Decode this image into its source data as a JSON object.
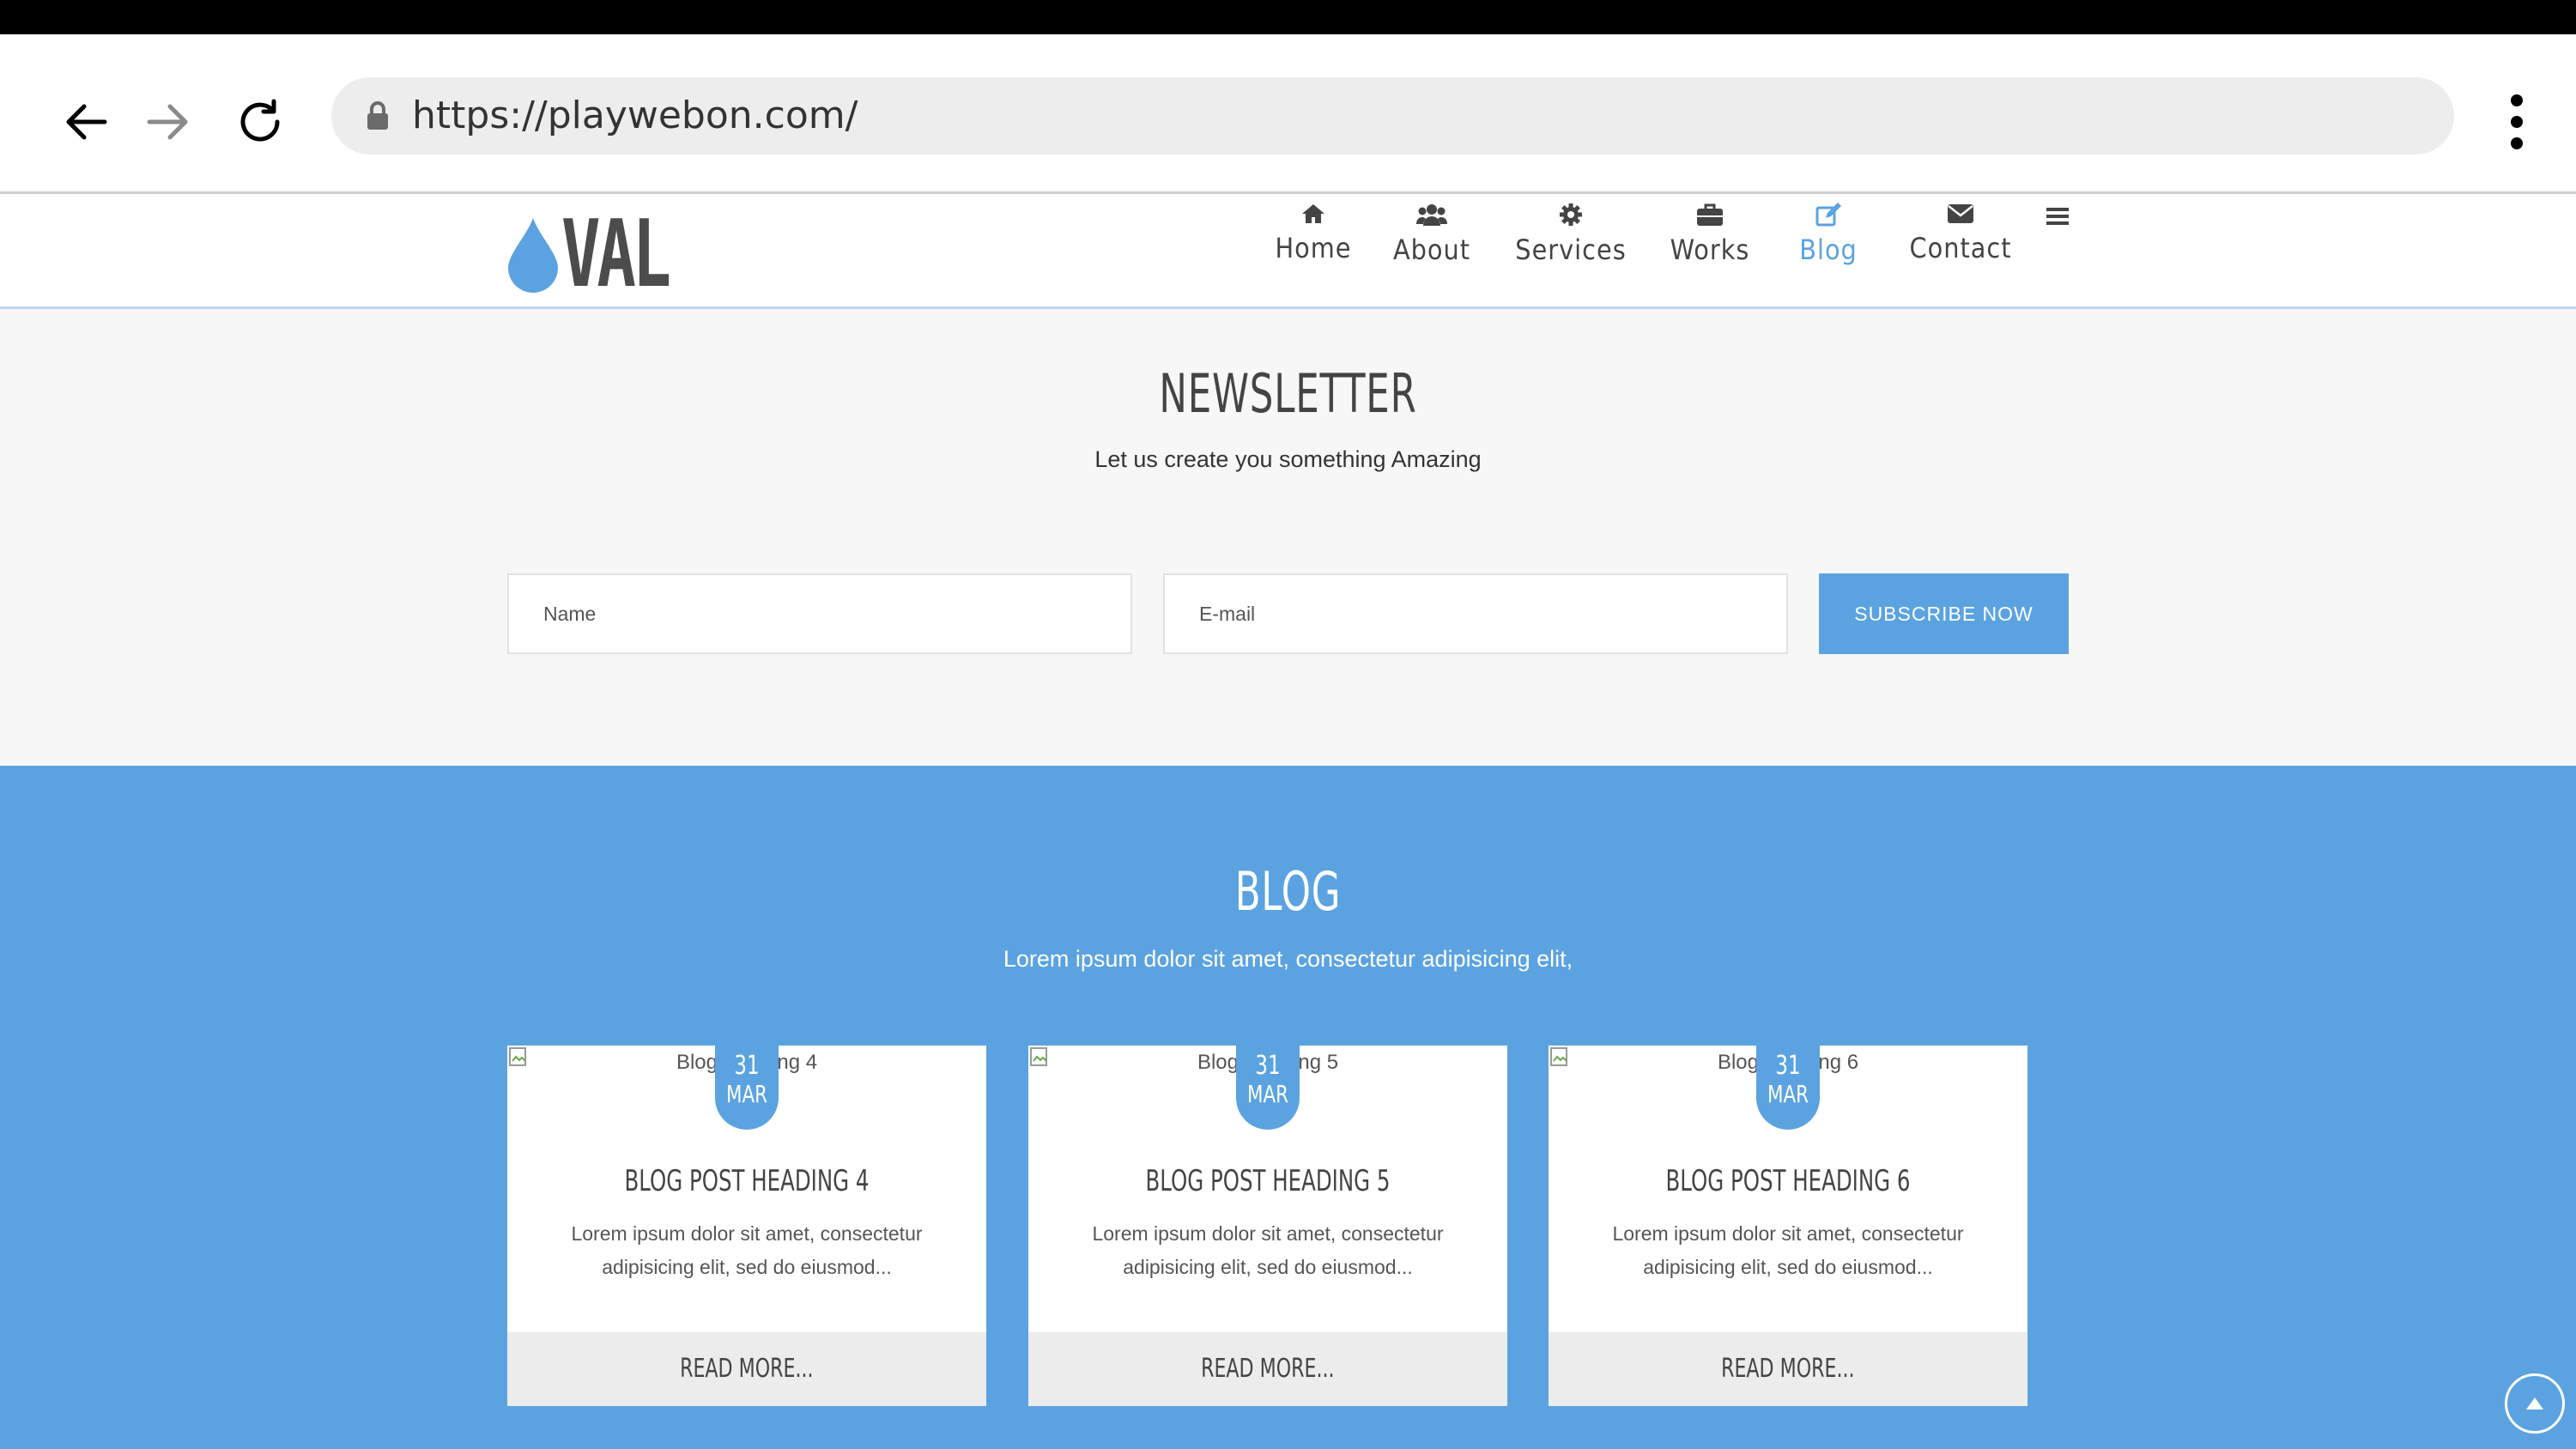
{
  "browser": {
    "url": "https://playwebon.com/",
    "icons": {
      "back": "arrow-left-icon",
      "forward": "arrow-right-icon",
      "reload": "reload-icon",
      "lock": "lock-icon",
      "menu": "kebab-menu-icon"
    }
  },
  "site": {
    "logo_text": "VAL",
    "logo_icon": "drop-icon",
    "nav": [
      {
        "label": "Home",
        "icon": "home-icon"
      },
      {
        "label": "About",
        "icon": "users-icon"
      },
      {
        "label": "Services",
        "icon": "gear-icon"
      },
      {
        "label": "Works",
        "icon": "briefcase-icon"
      },
      {
        "label": "Blog",
        "icon": "edit-icon",
        "active": true
      },
      {
        "label": "Contact",
        "icon": "envelope-icon"
      }
    ],
    "hamburger_icon": "hamburger-icon"
  },
  "newsletter": {
    "title": "NEWSLETTER",
    "subtitle": "Let us create you something Amazing",
    "name_placeholder": "Name",
    "email_placeholder": "E-mail",
    "subscribe_label": "SUBSCRIBE NOW"
  },
  "blog": {
    "title": "BLOG",
    "subtitle": "Lorem ipsum dolor sit amet, consectetur adipisicing elit,",
    "posts": [
      {
        "image_alt": "Blog Heading 4",
        "day": "31",
        "month": "MAR",
        "heading": "BLOG POST HEADING 4",
        "excerpt": "Lorem ipsum dolor sit amet, consectetur adipisicing elit, sed do eiusmod...",
        "read_more": "READ MORE..."
      },
      {
        "image_alt": "Blog Heading 5",
        "day": "31",
        "month": "MAR",
        "heading": "BLOG POST HEADING 5",
        "excerpt": "Lorem ipsum dolor sit amet, consectetur adipisicing elit, sed do eiusmod...",
        "read_more": "READ MORE..."
      },
      {
        "image_alt": "Blog Heading 6",
        "day": "31",
        "month": "MAR",
        "heading": "BLOG POST HEADING 6",
        "excerpt": "Lorem ipsum dolor sit amet, consectetur adipisicing elit, sed do eiusmod...",
        "read_more": "READ MORE..."
      }
    ]
  },
  "colors": {
    "accent": "#5ba3e0",
    "text": "#444444",
    "newsletter_bg": "#f7f7f7"
  }
}
